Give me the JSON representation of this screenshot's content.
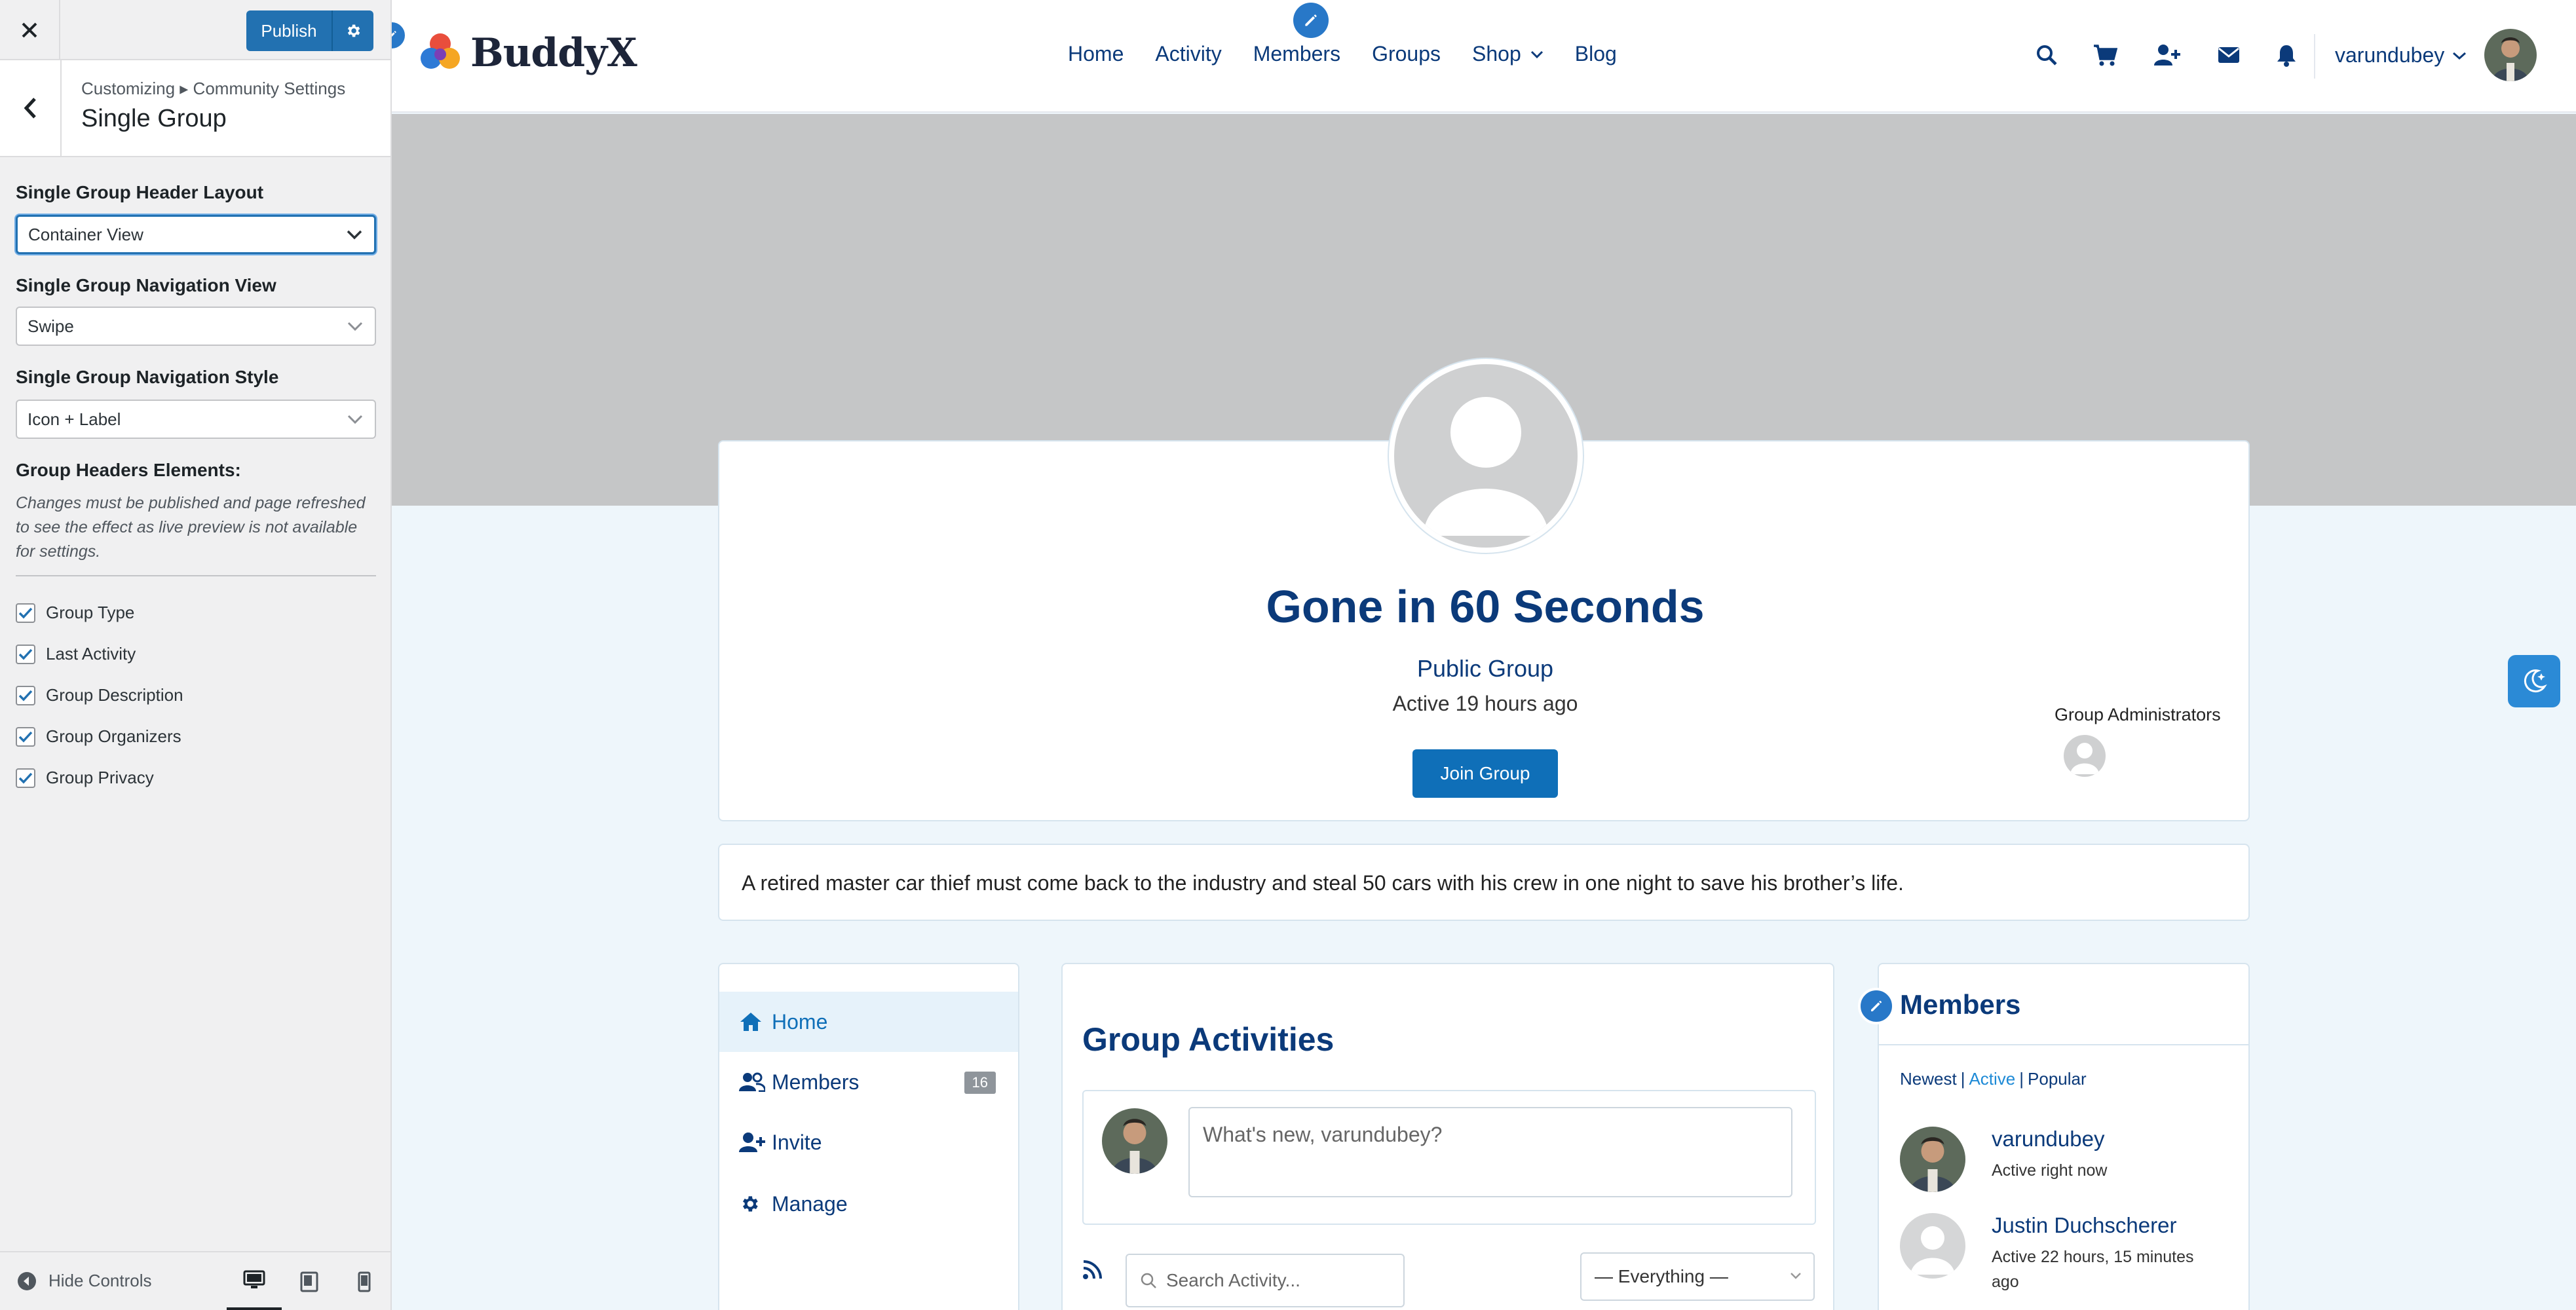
{
  "customizer": {
    "publish_label": "Publish",
    "breadcrumb": "Customizing ▸ Community Settings",
    "section_title": "Single Group",
    "fields": [
      {
        "label": "Single Group Header Layout",
        "value": "Container View"
      },
      {
        "label": "Single Group Navigation View",
        "value": "Swipe"
      },
      {
        "label": "Single Group Navigation Style",
        "value": "Icon + Label"
      }
    ],
    "elements_heading": "Group Headers Elements:",
    "elements_note": "Changes must be published and page refreshed to see the effect as live preview is not available for settings.",
    "checkboxes": [
      {
        "label": "Group Type",
        "checked": true
      },
      {
        "label": "Last Activity",
        "checked": true
      },
      {
        "label": "Group Description",
        "checked": true
      },
      {
        "label": "Group Organizers",
        "checked": true
      },
      {
        "label": "Group Privacy",
        "checked": true
      }
    ],
    "hide_controls": "Hide Controls",
    "accent": "#2271b1"
  },
  "site": {
    "logo_text": "BuddyX",
    "nav": [
      {
        "label": "Home"
      },
      {
        "label": "Activity"
      },
      {
        "label": "Members"
      },
      {
        "label": "Groups"
      },
      {
        "label": "Shop"
      },
      {
        "label": "Blog"
      }
    ],
    "header_icons": [
      "search-icon",
      "cart-icon",
      "add-friend-icon",
      "envelope-icon",
      "bell-icon"
    ],
    "username": "varundubey",
    "brand_color": "#0b3a7a"
  },
  "group": {
    "title": "Gone in 60 Seconds",
    "type": "Public Group",
    "last_active": "Active 19 hours ago",
    "join_label": "Join Group",
    "admins_label": "Group Administrators",
    "description": "A retired master car thief must come back to the industry and steal 50 cars with his crew in one night to save his brother’s life."
  },
  "group_nav": [
    {
      "label": "Home",
      "icon": "home-icon",
      "active": true
    },
    {
      "label": "Members",
      "icon": "users-icon",
      "badge": "16"
    },
    {
      "label": "Invite",
      "icon": "invite-icon"
    },
    {
      "label": "Manage",
      "icon": "gear-icon"
    }
  ],
  "activity": {
    "title": "Group Activities",
    "whats_new_placeholder": "What's new, varundubey?",
    "search_placeholder": "Search Activity...",
    "filter_value": "— Everything —"
  },
  "members_widget": {
    "title": "Members",
    "tabs": [
      {
        "label": "Newest"
      },
      {
        "label": "Active",
        "active": true
      },
      {
        "label": "Popular"
      }
    ],
    "list": [
      {
        "name": "varundubey",
        "status": "Active right now"
      },
      {
        "name": "Justin Duchscherer",
        "status": "Active 22 hours, 15 minutes ago"
      }
    ]
  }
}
